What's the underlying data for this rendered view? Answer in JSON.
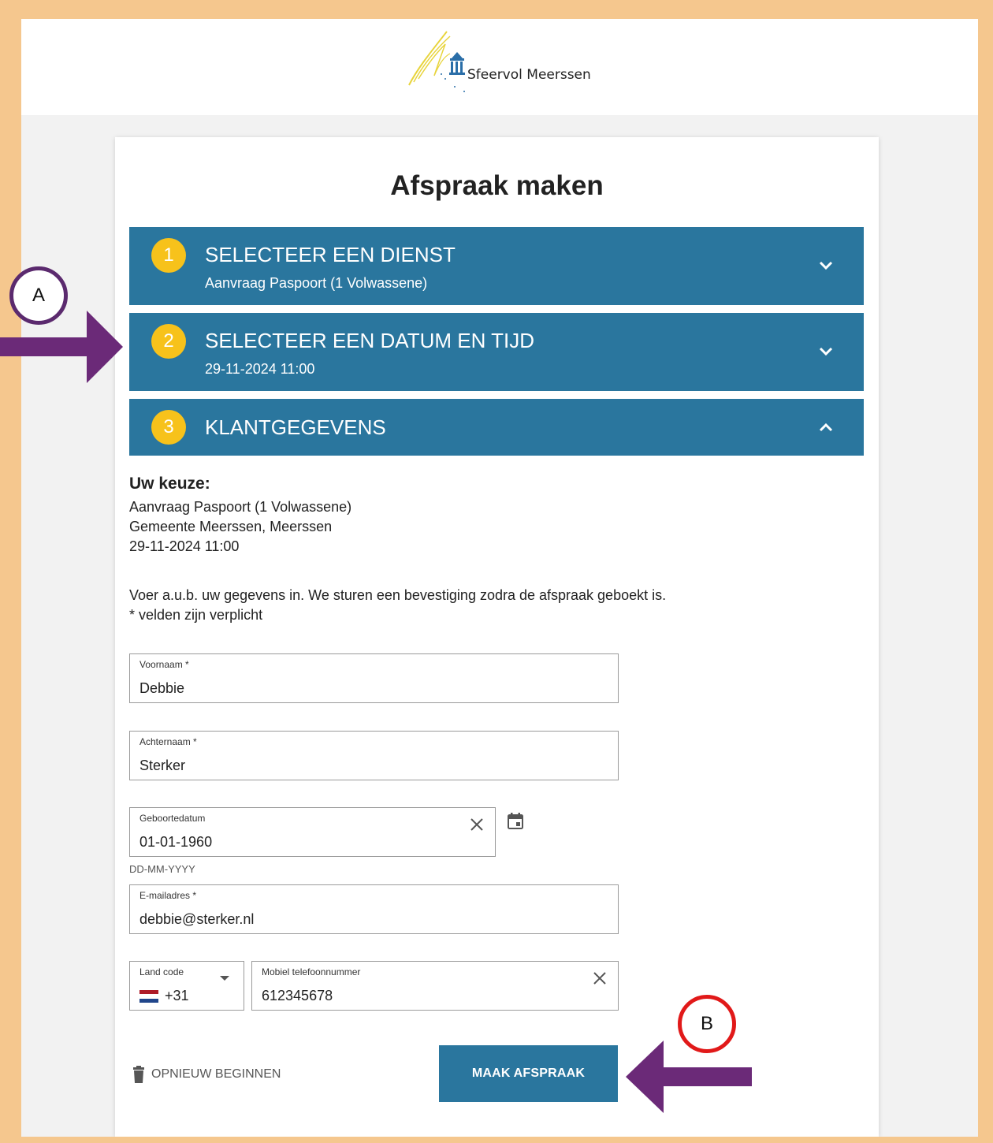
{
  "logo": {
    "text": "Sfeervol Meerssen"
  },
  "page_title": "Afspraak maken",
  "steps": [
    {
      "number": "1",
      "title": "SELECTEER EEN DIENST",
      "subtitle": "Aanvraag Paspoort (1 Volwassene)",
      "state": "collapsed"
    },
    {
      "number": "2",
      "title": "SELECTEER EEN DATUM EN TIJD",
      "subtitle": "29-11-2024 11:00",
      "state": "collapsed"
    },
    {
      "number": "3",
      "title": "KLANTGEGEVENS",
      "subtitle": "",
      "state": "expanded"
    }
  ],
  "choice": {
    "heading": "Uw keuze:",
    "lines": [
      "Aanvraag Paspoort (1 Volwassene)",
      "Gemeente Meerssen, Meerssen",
      "29-11-2024 11:00"
    ]
  },
  "intro": {
    "line1": "Voer a.u.b. uw gegevens in. We sturen een bevestiging zodra de afspraak geboekt is.",
    "line2": "* velden zijn verplicht"
  },
  "form": {
    "first_name": {
      "label": "Voornaam *",
      "value": "Debbie"
    },
    "last_name": {
      "label": "Achternaam *",
      "value": "Sterker"
    },
    "birth_date": {
      "label": "Geboortedatum",
      "value": "01-01-1960",
      "hint": "DD-MM-YYYY"
    },
    "email": {
      "label": "E-mailadres *",
      "value": "debbie@sterker.nl"
    },
    "country_code": {
      "label": "Land code",
      "value": "+31"
    },
    "mobile": {
      "label": "Mobiel telefoonnummer",
      "value": "612345678"
    }
  },
  "actions": {
    "restart_label": "OPNIEUW BEGINNEN",
    "submit_label": "MAAK AFSPRAAK"
  },
  "annotations": {
    "a_label": "A",
    "b_label": "B"
  },
  "colors": {
    "frame": "#f5c78e",
    "step_bar": "#2a769e",
    "step_number": "#f7c21b",
    "submit_button": "#2a769e",
    "annotation_a_ring": "#5b2a6e",
    "annotation_b_ring": "#e11919",
    "arrow": "#6b2a78"
  },
  "icons": [
    "logo-mark-icon",
    "chevron-down-icon",
    "chevron-up-icon",
    "clear-icon",
    "calendar-icon",
    "dropdown-caret-icon",
    "netherlands-flag-icon",
    "trash-icon",
    "arrow-right-icon",
    "arrow-left-icon"
  ]
}
